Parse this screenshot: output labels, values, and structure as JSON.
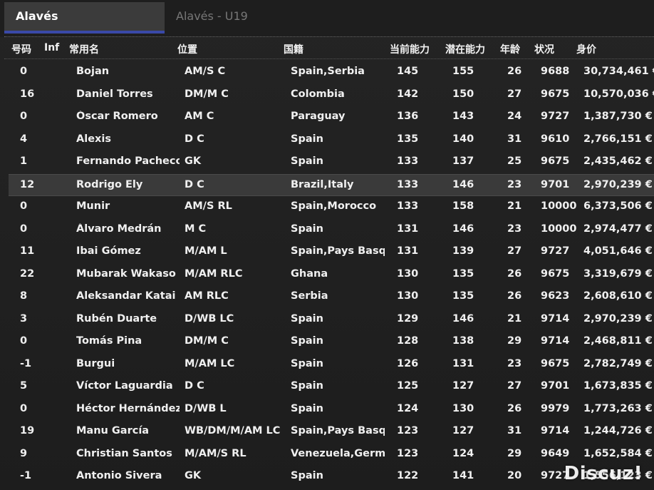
{
  "tabs": [
    {
      "label": "Alavés",
      "active": true
    },
    {
      "label": "Alavés - U19",
      "active": false
    }
  ],
  "columns": {
    "number": "号码",
    "inf": "Inf",
    "name": "常用名",
    "position": "位置",
    "nationality": "国籍",
    "ca": "当前能力",
    "pa": "潜在能力",
    "age": "年龄",
    "condition": "状况",
    "value": "身价"
  },
  "players": [
    {
      "number": "0",
      "name": "Bojan",
      "position": "AM/S C",
      "nationality": "Spain,Serbia",
      "ca": "145",
      "pa": "155",
      "age": "26",
      "condition": "9688",
      "value": "30,734,461 €"
    },
    {
      "number": "16",
      "name": "Daniel Torres",
      "position": "DM/M C",
      "nationality": "Colombia",
      "ca": "142",
      "pa": "150",
      "age": "27",
      "condition": "9675",
      "value": "10,570,036 €"
    },
    {
      "number": "0",
      "name": "Óscar Romero",
      "position": "AM C",
      "nationality": "Paraguay",
      "ca": "136",
      "pa": "143",
      "age": "24",
      "condition": "9727",
      "value": "1,387,730 €"
    },
    {
      "number": "4",
      "name": "Alexis",
      "position": "D C",
      "nationality": "Spain",
      "ca": "135",
      "pa": "140",
      "age": "31",
      "condition": "9610",
      "value": "2,766,151 €"
    },
    {
      "number": "1",
      "name": "Fernando Pacheco",
      "position": "GK",
      "nationality": "Spain",
      "ca": "133",
      "pa": "137",
      "age": "25",
      "condition": "9675",
      "value": "2,435,462 €"
    },
    {
      "number": "12",
      "name": "Rodrigo Ely",
      "position": "D C",
      "nationality": "Brazil,Italy",
      "ca": "133",
      "pa": "146",
      "age": "23",
      "condition": "9701",
      "value": "2,970,239 €",
      "selected": true
    },
    {
      "number": "0",
      "name": "Munir",
      "position": "AM/S RL",
      "nationality": "Spain,Morocco",
      "ca": "133",
      "pa": "158",
      "age": "21",
      "condition": "10000",
      "value": "6,373,506 €"
    },
    {
      "number": "0",
      "name": "Álvaro Medrán",
      "position": "M C",
      "nationality": "Spain",
      "ca": "131",
      "pa": "146",
      "age": "23",
      "condition": "10000",
      "value": "2,974,477 €"
    },
    {
      "number": "11",
      "name": "Ibai Gómez",
      "position": "M/AM L",
      "nationality": "Spain,Pays Basque",
      "ca": "131",
      "pa": "139",
      "age": "27",
      "condition": "9727",
      "value": "4,051,646 €"
    },
    {
      "number": "22",
      "name": "Mubarak Wakaso",
      "position": "M/AM RLC",
      "nationality": "Ghana",
      "ca": "130",
      "pa": "135",
      "age": "26",
      "condition": "9675",
      "value": "3,319,679 €"
    },
    {
      "number": "8",
      "name": "Aleksandar Katai",
      "position": "AM RLC",
      "nationality": "Serbia",
      "ca": "130",
      "pa": "135",
      "age": "26",
      "condition": "9623",
      "value": "2,608,610 €"
    },
    {
      "number": "3",
      "name": "Rubén Duarte",
      "position": "D/WB LC",
      "nationality": "Spain",
      "ca": "129",
      "pa": "146",
      "age": "21",
      "condition": "9714",
      "value": "2,970,239 €"
    },
    {
      "number": "0",
      "name": "Tomás Pina",
      "position": "DM/M C",
      "nationality": "Spain",
      "ca": "128",
      "pa": "138",
      "age": "29",
      "condition": "9714",
      "value": "2,468,811 €"
    },
    {
      "number": "-1",
      "name": "Burgui",
      "position": "M/AM LC",
      "nationality": "Spain",
      "ca": "126",
      "pa": "131",
      "age": "23",
      "condition": "9675",
      "value": "2,782,749 €"
    },
    {
      "number": "5",
      "name": "Víctor Laguardia",
      "position": "D C",
      "nationality": "Spain",
      "ca": "125",
      "pa": "127",
      "age": "27",
      "condition": "9701",
      "value": "1,673,835 €"
    },
    {
      "number": "0",
      "name": "Héctor Hernández",
      "position": "D/WB L",
      "nationality": "Spain",
      "ca": "124",
      "pa": "130",
      "age": "26",
      "condition": "9979",
      "value": "1,773,263 €"
    },
    {
      "number": "19",
      "name": "Manu García",
      "position": "WB/DM/M/AM LC",
      "nationality": "Spain,Pays Basque",
      "ca": "123",
      "pa": "127",
      "age": "31",
      "condition": "9714",
      "value": "1,244,726 €"
    },
    {
      "number": "9",
      "name": "Christian Santos",
      "position": "M/AM/S RL",
      "nationality": "Venezuela,German",
      "ca": "123",
      "pa": "124",
      "age": "29",
      "condition": "9649",
      "value": "1,652,584 €"
    },
    {
      "number": "-1",
      "name": "Antonio Sivera",
      "position": "GK",
      "nationality": "Spain",
      "ca": "122",
      "pa": "141",
      "age": "20",
      "condition": "9727",
      "value": "1,556,123 €"
    }
  ],
  "watermark": "Discuz!"
}
